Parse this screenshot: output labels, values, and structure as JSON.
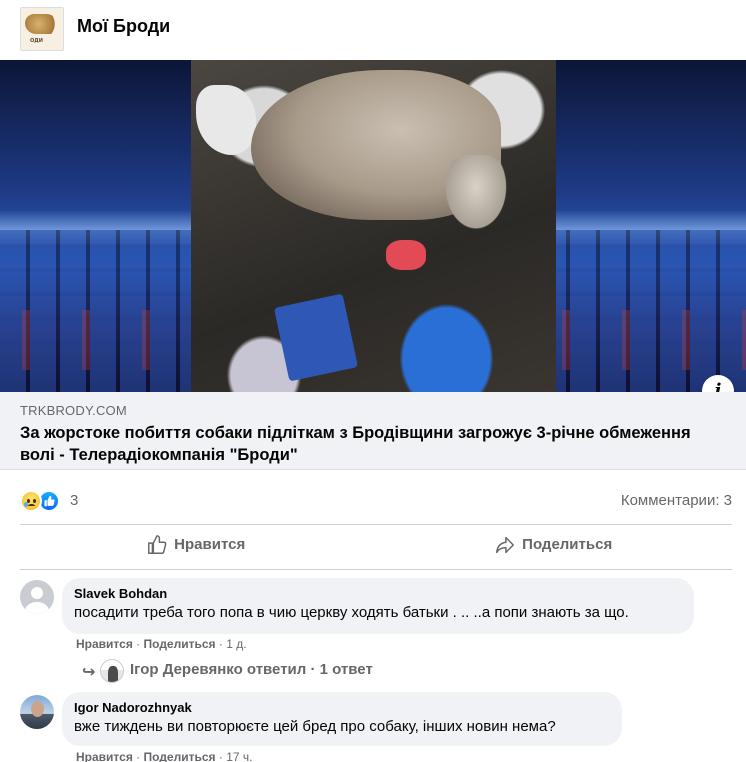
{
  "header": {
    "page_name": "Мої Броди"
  },
  "link_preview": {
    "domain": "TRKBRODY.COM",
    "title": "За жорстоке побиття собаки підліткам з Бродівщини загрожує 3-річне обмеження волі - Телерадіокомпанія \"Броди\"",
    "info_icon_glyph": "i"
  },
  "reactions": {
    "icons": [
      "sad-reaction",
      "like-reaction"
    ],
    "count": "3",
    "comments_label": "Комментарии: 3"
  },
  "actions": {
    "like_label": "Нравится",
    "share_label": "Поделиться"
  },
  "comments": [
    {
      "author": "Slavek Bohdan",
      "text": "посадити треба того попа в чию церкву ходять батьки . .. ..а попи знають за що.",
      "like_label": "Нравится",
      "reply_label": "Поделиться",
      "time": "1 д.",
      "reply_summary": "Ігор Деревянко ответил · 1 ответ"
    },
    {
      "author": "Igor Nadorozhnyak",
      "text": "вже тиждень ви повторюєте цей бред про собаку, інших новин нема?",
      "like_label": "Нравится",
      "reply_label": "Поделиться",
      "time": "17 ч."
    }
  ],
  "colors": {
    "secondary_text": "#65676b",
    "bubble_bg": "#f0f2f5",
    "like_blue": "#0866ff"
  }
}
